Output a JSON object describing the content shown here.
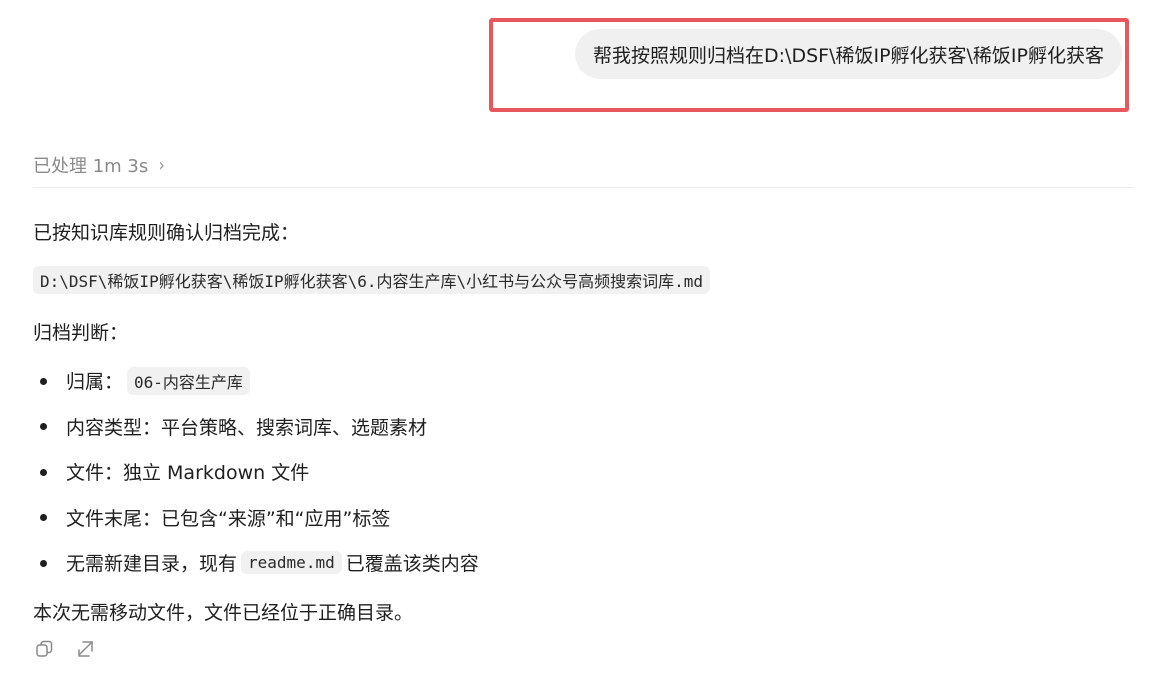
{
  "user_message": {
    "text": "帮我按照规则归档在D:\\DSF\\稀饭IP孵化获客\\稀饭IP孵化获客"
  },
  "processing": {
    "label": "已处理 1m 3s",
    "chevron": "›"
  },
  "response": {
    "intro": "已按知识库规则确认归档完成：",
    "path": "D:\\DSF\\稀饭IP孵化获客\\稀饭IP孵化获客\\6.内容生产库\\小红书与公众号高频搜索词库.md",
    "judgement_heading": "归档判断：",
    "bullets": [
      {
        "prefix": "归属：",
        "code": "06-内容生产库",
        "suffix": ""
      },
      {
        "prefix": "内容类型：平台策略、搜索词库、选题素材",
        "code": "",
        "suffix": ""
      },
      {
        "prefix": "文件：独立 Markdown 文件",
        "code": "",
        "suffix": ""
      },
      {
        "prefix": "文件末尾：已包含“来源”和“应用”标签",
        "code": "",
        "suffix": ""
      },
      {
        "prefix": "无需新建目录，现有",
        "code": "readme.md",
        "suffix": "已覆盖该类内容"
      }
    ],
    "conclusion": "本次无需移动文件，文件已经位于正确目录。"
  },
  "actions": {
    "copy_icon": "copy-icon",
    "share_icon": "share-icon"
  },
  "colors": {
    "highlight_border": "#e8575b",
    "bubble_bg": "#f0f0f0",
    "muted_text": "#8a8a8a",
    "code_bg": "#f1f1f1"
  }
}
